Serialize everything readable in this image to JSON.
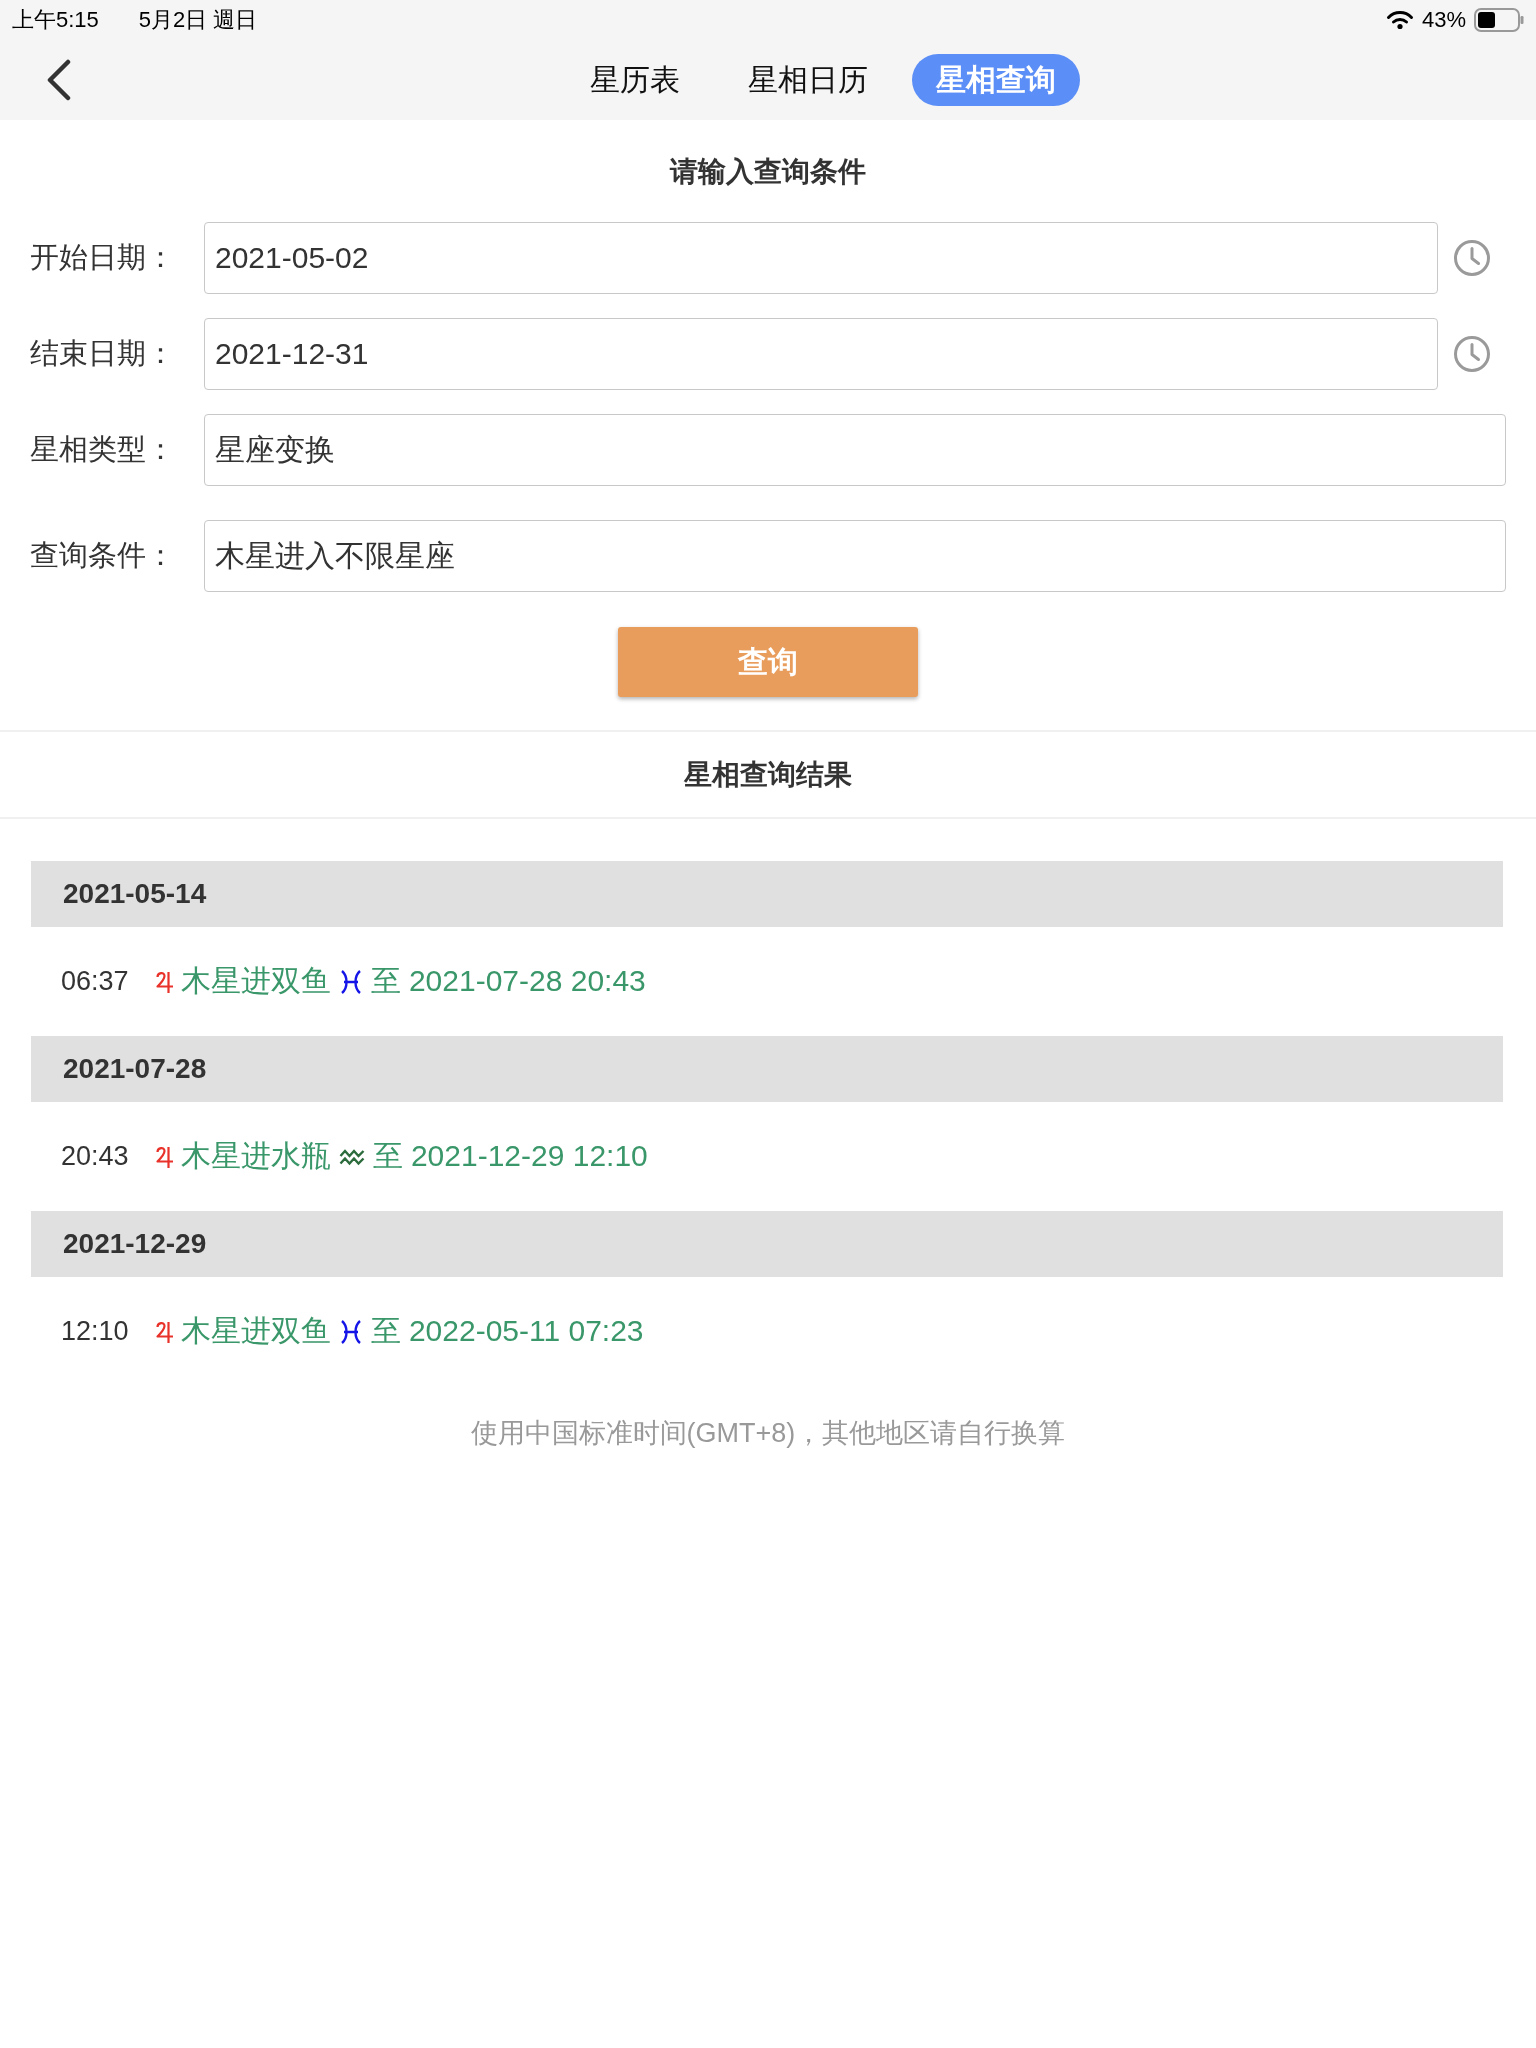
{
  "status_bar": {
    "time": "上午5:15",
    "date": "5月2日 週日",
    "battery": "43%"
  },
  "nav": {
    "tabs": [
      {
        "label": "星历表",
        "selected": false
      },
      {
        "label": "星相日历",
        "selected": false
      },
      {
        "label": "星相查询",
        "selected": true
      }
    ]
  },
  "query_form": {
    "title": "请输入查询条件",
    "fields": [
      {
        "kind": "date",
        "label": "开始日期：",
        "value": "2021-05-02"
      },
      {
        "kind": "date",
        "label": "结束日期：",
        "value": "2021-12-31"
      },
      {
        "kind": "picker",
        "label": "星相类型：",
        "value": "星座变换"
      },
      {
        "kind": "picker",
        "label": "查询条件：",
        "value": "木星进入不限星座"
      }
    ],
    "submit": "查询"
  },
  "results": {
    "title": "星相查询结果",
    "groups": [
      {
        "date": "2021-05-14",
        "events": [
          {
            "time": "06:37",
            "planet": {
              "kind": "jupiter",
              "color": "#e8322a"
            },
            "text": "木星进双鱼",
            "sign": {
              "kind": "pisces",
              "color": "#1515e8"
            },
            "until": "至 2021-07-28 20:43"
          }
        ]
      },
      {
        "date": "2021-07-28",
        "events": [
          {
            "time": "20:43",
            "planet": {
              "kind": "jupiter",
              "color": "#e8322a"
            },
            "text": "木星进水瓶",
            "sign": {
              "kind": "aquarius",
              "color": "#2b6b3c"
            },
            "until": "至 2021-12-29 12:10"
          }
        ]
      },
      {
        "date": "2021-12-29",
        "events": [
          {
            "time": "12:10",
            "planet": {
              "kind": "jupiter",
              "color": "#e8322a"
            },
            "text": "木星进双鱼",
            "sign": {
              "kind": "pisces",
              "color": "#1515e8"
            },
            "until": "至 2022-05-11 07:23"
          }
        ]
      }
    ]
  },
  "footer_note": "使用中国标准时间(GMT+8)，其他地区请自行换算"
}
